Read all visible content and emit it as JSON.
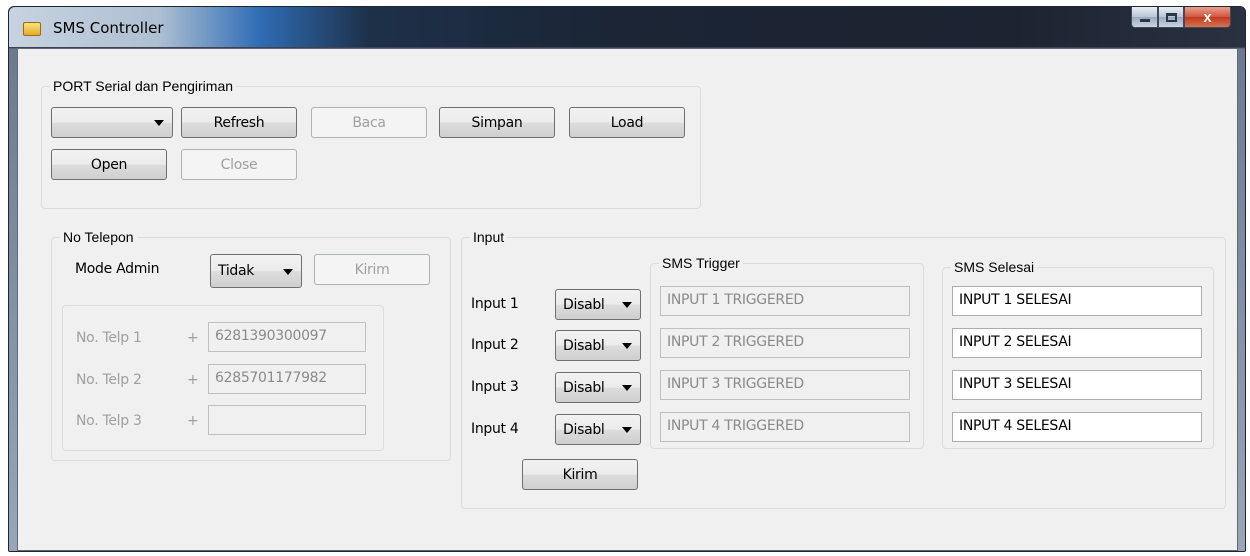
{
  "window": {
    "title": "SMS Controller",
    "close_glyph": "x"
  },
  "port_group": {
    "legend": "PORT Serial dan Pengiriman",
    "port_select_value": "",
    "buttons": {
      "refresh": "Refresh",
      "baca": "Baca",
      "simpan": "Simpan",
      "load": "Load",
      "open": "Open",
      "close": "Close"
    }
  },
  "phone_group": {
    "legend": "No Telepon",
    "mode_admin_label": "Mode Admin",
    "mode_admin_value": "Tidak",
    "kirim": "Kirim",
    "plus": "+",
    "rows": [
      {
        "label": "No. Telp 1",
        "value": "6281390300097"
      },
      {
        "label": "No. Telp 2",
        "value": "6285701177982"
      },
      {
        "label": "No. Telp 3",
        "value": ""
      }
    ]
  },
  "input_group": {
    "legend": "Input",
    "trigger_legend": "SMS Trigger",
    "selesai_legend": "SMS Selesai",
    "kirim": "Kirim",
    "rows": [
      {
        "label": "Input 1",
        "mode": "Disabl",
        "trigger": "INPUT 1 TRIGGERED",
        "selesai": "INPUT 1 SELESAI"
      },
      {
        "label": "Input 2",
        "mode": "Disabl",
        "trigger": "INPUT 2 TRIGGERED",
        "selesai": "INPUT 2 SELESAI"
      },
      {
        "label": "Input 3",
        "mode": "Disabl",
        "trigger": "INPUT 3 TRIGGERED",
        "selesai": "INPUT 3 SELESAI"
      },
      {
        "label": "Input 4",
        "mode": "Disabl",
        "trigger": "INPUT 4 TRIGGERED",
        "selesai": "INPUT 4 SELESAI"
      }
    ]
  }
}
